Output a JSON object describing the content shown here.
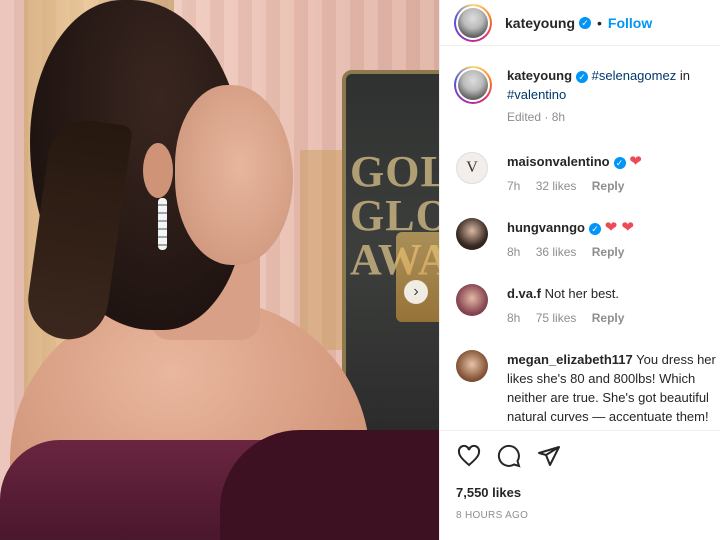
{
  "post": {
    "author": "kateyoung",
    "follow_label": "Follow",
    "caption_user": "kateyoung",
    "caption_tag": "#selenagomez",
    "caption_in": "in",
    "caption_tag2": "#valentino",
    "caption_meta": "Edited · 8h",
    "likes": "7,550 likes",
    "posted": "8 HOURS AGO",
    "photo_sign": "GOLDEN GLOBE AWARDS"
  },
  "comments": [
    {
      "user": "maisonvalentino",
      "text": "",
      "time": "7h",
      "likes": "32 likes",
      "reply": "Reply",
      "hearts": "❤"
    },
    {
      "user": "hungvanngo",
      "text": "",
      "time": "8h",
      "likes": "36 likes",
      "reply": "Reply",
      "hearts": "❤ ❤"
    },
    {
      "user": "d.va.f",
      "text": "Not her best.",
      "time": "8h",
      "likes": "75 likes",
      "reply": "Reply",
      "hearts": ""
    },
    {
      "user": "megan_elizabeth117",
      "text": "You dress her likes she's 80 and 800lbs! Which neither are true. She's got beautiful natural curves — accentuate them!",
      "time": "",
      "likes": "",
      "reply": "",
      "hearts": ""
    }
  ],
  "icons": [
    "heart-icon",
    "comment-icon",
    "share-icon",
    "verified-badge-icon",
    "chevron-right-icon"
  ],
  "colors": {
    "accent": "#0095f6",
    "heart": "#ed4956",
    "muted": "#8e8e8e"
  }
}
